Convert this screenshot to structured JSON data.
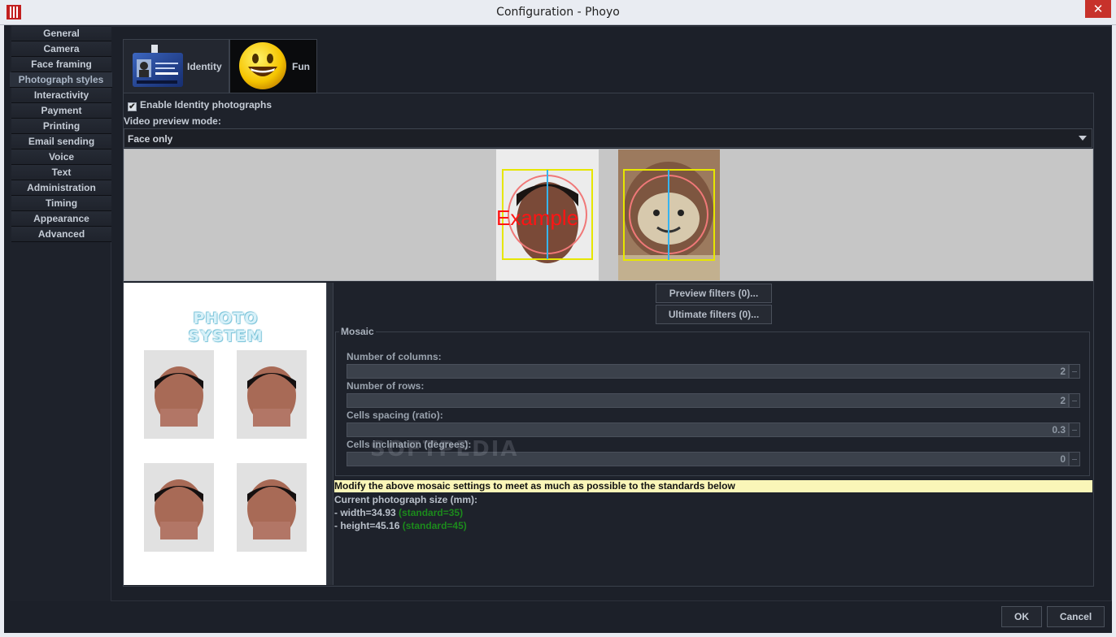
{
  "window": {
    "title": "Configuration - Phoyo",
    "close_glyph": "✕"
  },
  "sidebar": {
    "items": [
      {
        "label": "General"
      },
      {
        "label": "Camera"
      },
      {
        "label": "Face framing"
      },
      {
        "label": "Photograph styles",
        "active": true
      },
      {
        "label": "Interactivity"
      },
      {
        "label": "Payment"
      },
      {
        "label": "Printing"
      },
      {
        "label": "Email sending"
      },
      {
        "label": "Voice"
      },
      {
        "label": "Text"
      },
      {
        "label": "Administration"
      },
      {
        "label": "Timing"
      },
      {
        "label": "Appearance"
      },
      {
        "label": "Advanced"
      }
    ]
  },
  "tabs": [
    {
      "label": "Identity",
      "icon": "id-card-icon",
      "selected": true
    },
    {
      "label": "Fun",
      "icon": "smiley-icon",
      "selected": false
    }
  ],
  "identity": {
    "enable_label": "Enable Identity photographs",
    "enable_checked": true,
    "checkmark": "✔",
    "video_preview_label": "Video preview mode:",
    "video_preview_value": "Face only",
    "example_text": "Example",
    "mosaic_logo_text": "PHOTO SYSTEM",
    "preview_filters_label": "Preview filters (0)...",
    "ultimate_filters_label": "Ultimate filters (0)...",
    "mosaic": {
      "legend": "Mosaic",
      "columns_label": "Number of columns:",
      "columns_value": "2",
      "rows_label": "Number of rows:",
      "rows_value": "2",
      "spacing_label": "Cells spacing (ratio):",
      "spacing_value": "0.3",
      "inclination_label": "Cells inclination (degrees):",
      "inclination_value": "0"
    },
    "watermark": "SOFTPEDIA",
    "notice": "Modify the above mosaic settings to meet as much as possible to the standards below",
    "size_heading": "Current photograph size (mm):",
    "width_text": "- width=34.93",
    "width_standard": "(standard=35)",
    "height_text": "- height=45.16",
    "height_standard": "(standard=45)"
  },
  "footer": {
    "ok_label": "OK",
    "cancel_label": "Cancel"
  }
}
